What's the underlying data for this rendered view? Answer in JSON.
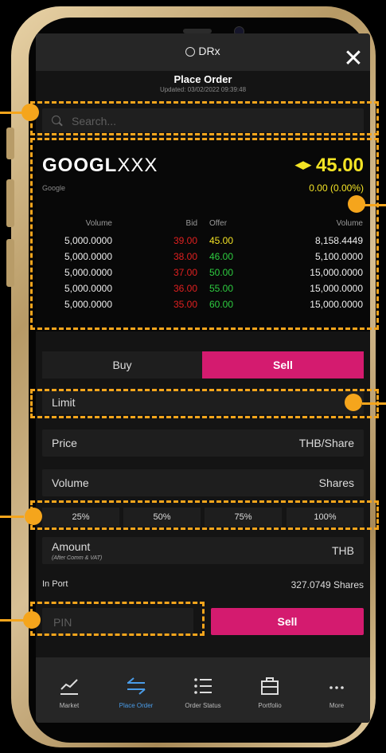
{
  "app": {
    "brand": "DRx",
    "title": "Place Order",
    "updated": "Updated: 03/02/2022 09:39:48"
  },
  "search": {
    "placeholder": "Search..."
  },
  "quote": {
    "symbol_main": "GOOGL",
    "symbol_suffix": "XXX",
    "company": "Google",
    "price": "45.00",
    "change": "0.00 (0.00%)",
    "price_color": "#f3e325"
  },
  "order_book": {
    "headers": {
      "volume_left": "Volume",
      "bid": "Bid",
      "offer": "Offer",
      "volume_right": "Volume"
    },
    "rows": [
      {
        "bid_volume": "5,000.0000",
        "bid": "39.00",
        "offer": "45.00",
        "offer_volume": "8,158.4449"
      },
      {
        "bid_volume": "5,000.0000",
        "bid": "38.00",
        "offer": "46.00",
        "offer_volume": "5,100.0000"
      },
      {
        "bid_volume": "5,000.0000",
        "bid": "37.00",
        "offer": "50.00",
        "offer_volume": "15,000.0000"
      },
      {
        "bid_volume": "5,000.0000",
        "bid": "36.00",
        "offer": "55.00",
        "offer_volume": "15,000.0000"
      },
      {
        "bid_volume": "5,000.0000",
        "bid": "35.00",
        "offer": "60.00",
        "offer_volume": "15,000.0000"
      }
    ],
    "colors": {
      "bid": "#e02020",
      "offer_match": "#f3e325",
      "offer": "#2ecc40"
    }
  },
  "side_tabs": {
    "buy": "Buy",
    "sell": "Sell",
    "active": "Sell",
    "sell_color": "#d41b6f"
  },
  "order_type": {
    "label": "Limit"
  },
  "price_field": {
    "label": "Price",
    "unit": "THB/Share"
  },
  "volume_field": {
    "label": "Volume",
    "unit": "Shares"
  },
  "percent_buttons": [
    "25%",
    "50%",
    "75%",
    "100%"
  ],
  "amount_field": {
    "label": "Amount",
    "sublabel": "(After Comm & VAT)",
    "unit": "THB"
  },
  "in_port": {
    "label": "In Port",
    "value": "327.0749 Shares"
  },
  "pin_field": {
    "placeholder": "PIN"
  },
  "submit": {
    "label": "Sell"
  },
  "bottom_nav": [
    {
      "label": "Market",
      "icon": "chart-line-icon"
    },
    {
      "label": "Place Order",
      "icon": "swap-arrows-icon",
      "active": true
    },
    {
      "label": "Order Status",
      "icon": "list-icon"
    },
    {
      "label": "Portfolio",
      "icon": "briefcase-icon"
    },
    {
      "label": "More",
      "icon": "more-dots-icon"
    }
  ],
  "annotation_color": "#f5a51c"
}
